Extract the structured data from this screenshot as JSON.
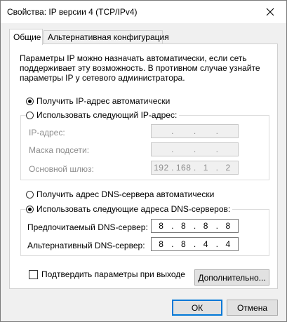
{
  "window": {
    "title": "Свойства: IP версии 4 (TCP/IPv4)",
    "close_icon": "close-icon"
  },
  "tabs": [
    {
      "label": "Общие",
      "active": true
    },
    {
      "label": "Альтернативная конфигурация",
      "active": false
    }
  ],
  "description": {
    "line1": "Параметры IP можно назначать автоматически, если сеть",
    "line2": "поддерживает эту возможность. В противном случае узнайте",
    "line3": "параметры IP у сетевого администратора."
  },
  "ip": {
    "auto_label": "Получить IP-адрес автоматически",
    "auto_selected": true,
    "manual_label": "Использовать следующий IP-адрес:",
    "manual_selected": false,
    "address_label": "IP-адрес:",
    "address": [
      " ",
      " ",
      " ",
      " "
    ],
    "mask_label": "Маска подсети:",
    "mask": [
      " ",
      " ",
      " ",
      " "
    ],
    "gateway_label": "Основной шлюз:",
    "gateway": [
      "192",
      "168",
      "1",
      "2"
    ]
  },
  "dns": {
    "auto_label": "Получить адрес DNS-сервера автоматически",
    "auto_selected": false,
    "manual_label": "Использовать следующие адреса DNS-серверов:",
    "manual_selected": true,
    "preferred_label": "Предпочитаемый DNS-сервер:",
    "preferred": [
      "8",
      "8",
      "8",
      "8"
    ],
    "alternate_label": "Альтернативный DNS-сервер:",
    "alternate": [
      "8",
      "8",
      "4",
      "4"
    ]
  },
  "validate": {
    "label": "Подтвердить параметры при выходе",
    "checked": false
  },
  "buttons": {
    "advanced": "Дополнительно...",
    "ok": "ОК",
    "cancel": "Отмена"
  }
}
